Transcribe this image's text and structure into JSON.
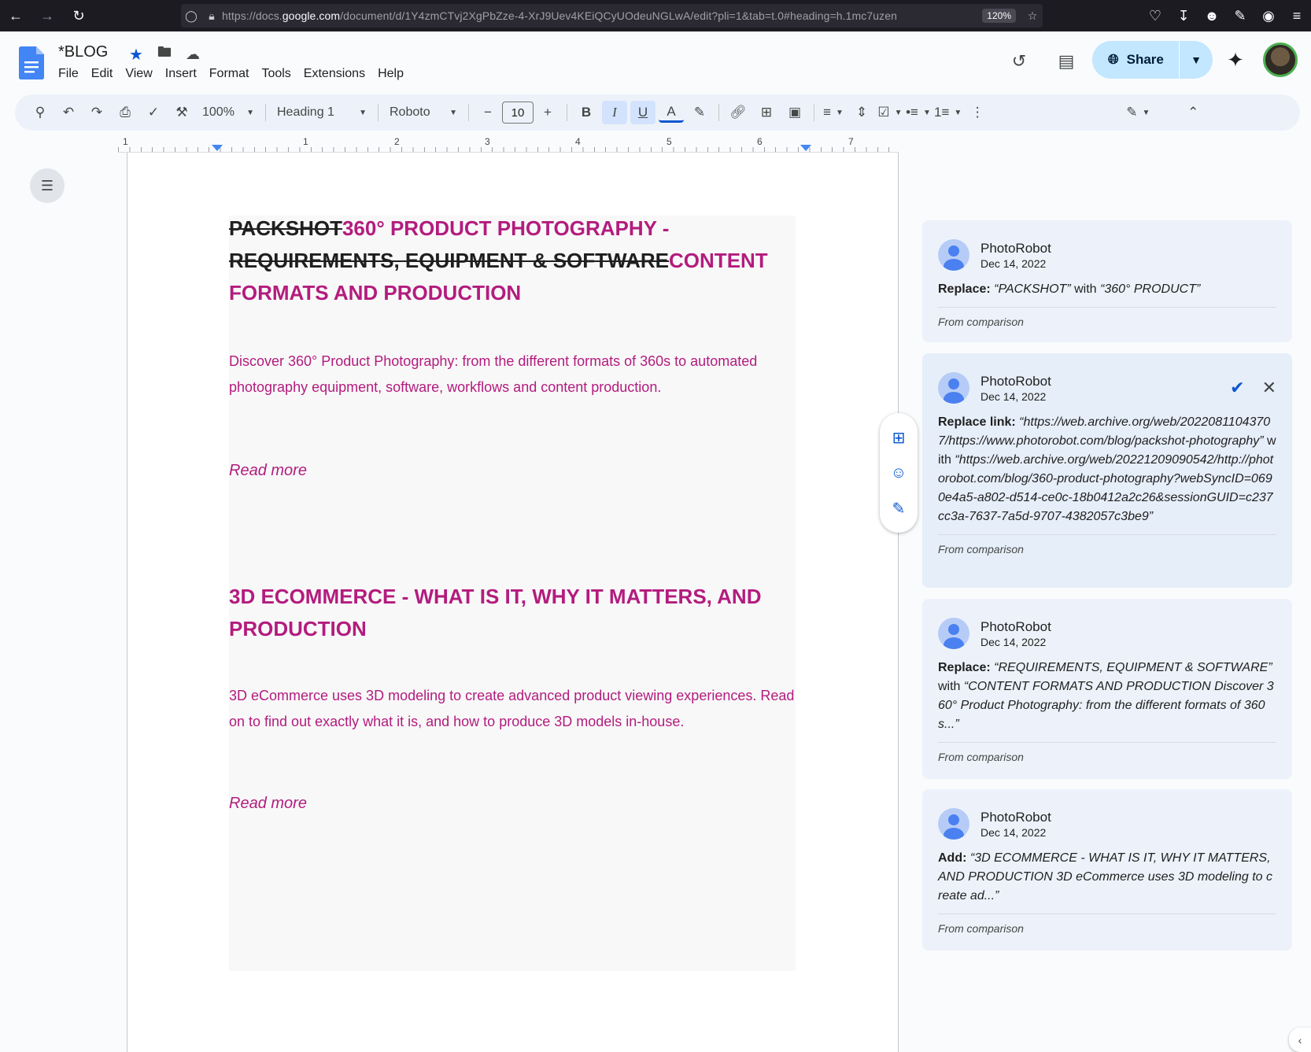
{
  "browser": {
    "url_prefix": "https://docs.",
    "url_host": "google.com",
    "url_rest": "/document/d/1Y4zmCTvj2XgPbZze-4-XrJ9Uev4KEiQCyUOdeuNGLwA/edit?pli=1&tab=t.0#heading=h.1mc7uzen",
    "zoom": "120%"
  },
  "doc": {
    "title": "*BLOG",
    "menu": [
      "File",
      "Edit",
      "View",
      "Insert",
      "Format",
      "Tools",
      "Extensions",
      "Help"
    ],
    "share_label": "Share"
  },
  "toolbar": {
    "zoom": "100%",
    "style": "Heading 1",
    "font": "Roboto",
    "font_size": "10"
  },
  "ruler": {
    "labels": [
      "1",
      "1",
      "2",
      "3",
      "4",
      "5",
      "6",
      "7"
    ]
  },
  "content": {
    "h1_del_1": "PACKSHOT",
    "h1_ins_1": "360° PRODUCT PHOTOGRAPHY - ",
    "h1_del_2": "REQUIREMENTS, EQUIPMENT & SOFTWARE",
    "h1_ins_2": "CONTENT FORMATS AND PRODUCTION",
    "p1": "Discover 360° Product Photography: from the different formats of 360s to automated photography equipment, software, workflows and content production.",
    "readmore_1": "Read more",
    "h2": "3D ECOMMERCE - WHAT IS IT, WHY IT MATTERS, AND PRODUCTION",
    "p2": "3D eCommerce uses 3D modeling to create advanced product viewing experiences. Read on to find out exactly what it is, and how to produce 3D models in-house.",
    "readmore_2": "Read more"
  },
  "comments": [
    {
      "author": "PhotoRobot",
      "date": "Dec 14, 2022",
      "action": "Replace:",
      "text_a": "“PACKSHOT”",
      "connector": "with",
      "text_b": "“360° PRODUCT”",
      "footer": "From comparison"
    },
    {
      "author": "PhotoRobot",
      "date": "Dec 14, 2022",
      "action": "Replace link:",
      "text_a": "“https://web.archive.org/web/20220811043707/https://www.photorobot.com/blog/packshot-photography”",
      "connector": "with",
      "text_b": "“https://web.archive.org/web/20221209090542/http://photorobot.com/blog/360-product-photography?webSyncID=0690e4a5-a802-d514-ce0c-18b0412a2c26&sessionGUID=c237cc3a-7637-7a5d-9707-4382057c3be9”",
      "footer": "From comparison"
    },
    {
      "author": "PhotoRobot",
      "date": "Dec 14, 2022",
      "action": "Replace:",
      "text_a": "“REQUIREMENTS, EQUIPMENT & SOFTWARE”",
      "connector": "with",
      "text_b": "“CONTENT FORMATS AND PRODUCTION Discover 360° Product Photography: from the different formats of 360s...”",
      "footer": "From comparison"
    },
    {
      "author": "PhotoRobot",
      "date": "Dec 14, 2022",
      "action": "Add:",
      "text_a": "“3D ECOMMERCE - WHAT IS IT, WHY IT MATTERS, AND PRODUCTION 3D eCommerce uses 3D modeling to create ad...”",
      "footer": "From comparison"
    }
  ],
  "colors": {
    "suggestion": "#b31c7e",
    "accent": "#0b57d0",
    "share_bg": "#c2e7ff"
  }
}
